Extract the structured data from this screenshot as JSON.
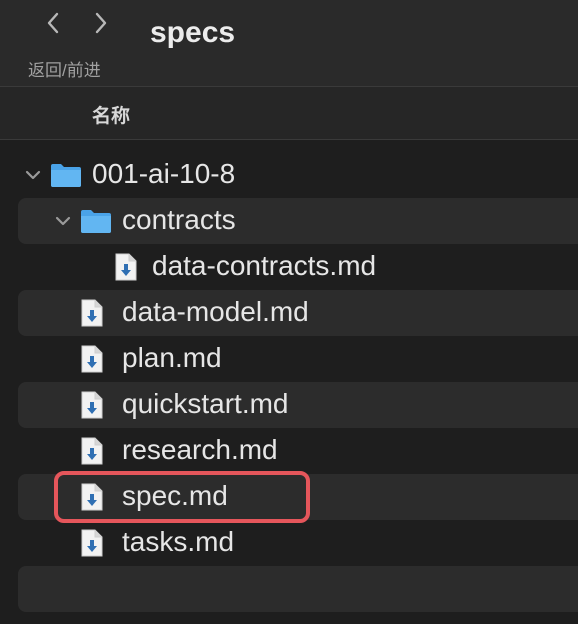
{
  "toolbar": {
    "back_label": "‹",
    "forward_label": "›",
    "nav_caption": "返回/前进",
    "title": "specs"
  },
  "column_header": {
    "name_label": "名称"
  },
  "items": [
    {
      "label": "001-ai-10-8",
      "type": "folder",
      "expanded": true,
      "level": 0
    },
    {
      "label": "contracts",
      "type": "folder",
      "expanded": true,
      "level": 1
    },
    {
      "label": "data-contracts.md",
      "type": "file",
      "level": 2
    },
    {
      "label": "data-model.md",
      "type": "file",
      "level": 1
    },
    {
      "label": "plan.md",
      "type": "file",
      "level": 1
    },
    {
      "label": "quickstart.md",
      "type": "file",
      "level": 1
    },
    {
      "label": "research.md",
      "type": "file",
      "level": 1
    },
    {
      "label": "spec.md",
      "type": "file",
      "level": 1,
      "highlighted": true
    },
    {
      "label": "tasks.md",
      "type": "file",
      "level": 1
    }
  ],
  "colors": {
    "folder": "#4aa3e8",
    "highlight": "#e5565b",
    "background": "#1e1e1e",
    "alt_row": "#2c2c2c"
  },
  "icons": {
    "folder": "folder-icon",
    "file": "markdown-file-icon",
    "disclosure": "chevron-down-icon"
  }
}
